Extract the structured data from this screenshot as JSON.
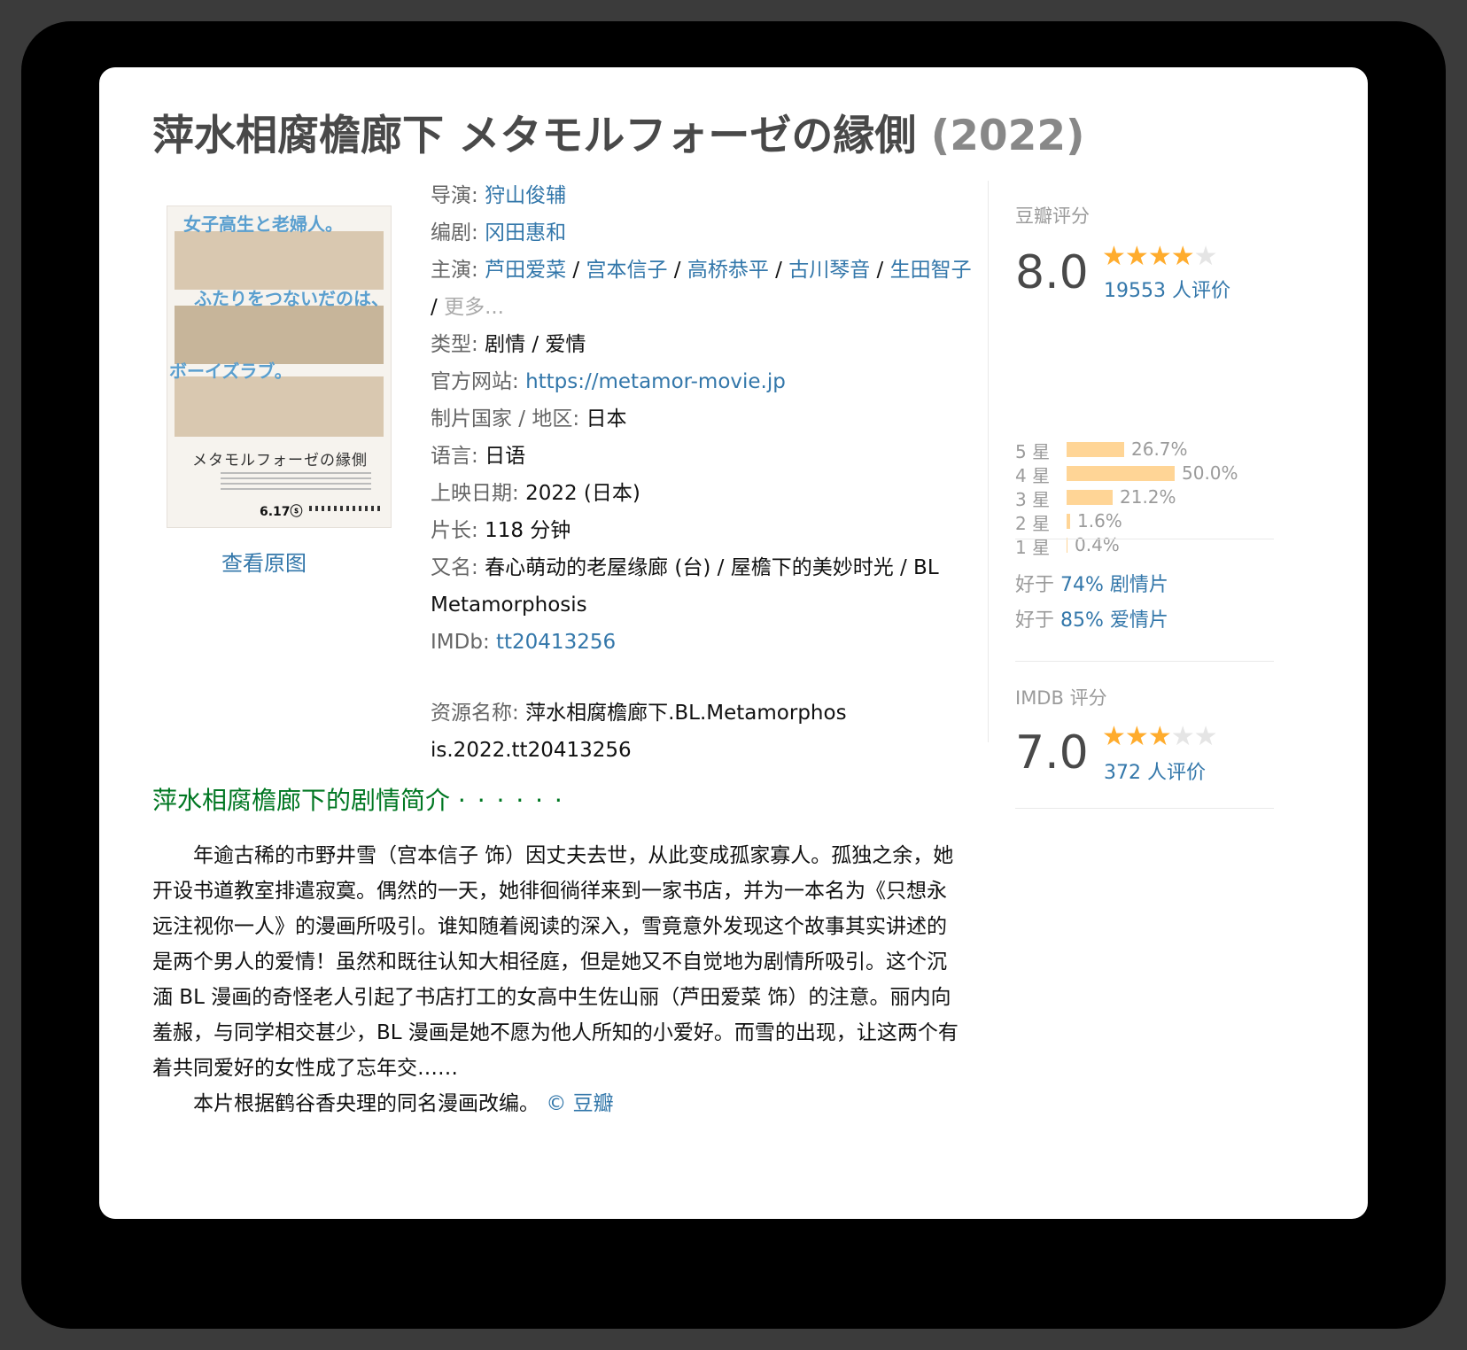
{
  "title": "萍水相腐檐廊下 メタモルフォーゼの縁側",
  "year": "(2022)",
  "poster": {
    "caption1": "女子高生と老婦人。",
    "caption2": "ふたりをつないだのは、",
    "caption3": "ボーイズラブ。",
    "title_jp": "メタモルフォーゼの縁側",
    "date": "6.17ⓢ",
    "view_original": "查看原图"
  },
  "info": {
    "director_label": "导演",
    "director": "狩山俊辅",
    "writer_label": "编剧",
    "writer": "冈田惠和",
    "cast_label": "主演",
    "cast": [
      "芦田爱菜",
      "宫本信子",
      "高桥恭平",
      "古川琴音",
      "生田智子"
    ],
    "cast_more": "更多...",
    "genre_label": "类型",
    "genre": "剧情 / 爱情",
    "website_label": "官方网站",
    "website": "https://metamor-movie.jp",
    "country_label": "制片国家 / 地区",
    "country": "日本",
    "language_label": "语言",
    "language": "日语",
    "release_label": "上映日期",
    "release": "2022 (日本)",
    "runtime_label": "片长",
    "runtime": "118 分钟",
    "aka_label": "又名",
    "aka": "春心萌动的老屋缘廊 (台) / 屋檐下的美妙时光 / BL Metamorphosis",
    "imdb_label": "IMDb",
    "imdb": "tt20413256",
    "resource_label": "资源名称",
    "resource": "萍水相腐檐廊下.BL.Metamorphosis.2022.tt20413256"
  },
  "douban": {
    "label": "豆瓣评分",
    "score": "8.0",
    "stars": 4,
    "count": "19553 人评价",
    "distribution": [
      {
        "label": "5 星",
        "percent": 26.7,
        "text": "26.7%"
      },
      {
        "label": "4 星",
        "percent": 50.0,
        "text": "50.0%"
      },
      {
        "label": "3 星",
        "percent": 21.2,
        "text": "21.2%"
      },
      {
        "label": "2 星",
        "percent": 1.6,
        "text": "1.6%"
      },
      {
        "label": "1 星",
        "percent": 0.4,
        "text": "0.4%"
      }
    ],
    "better1_prefix": "好于",
    "better1_link": "74% 剧情片",
    "better2_prefix": "好于",
    "better2_link": "85% 爱情片"
  },
  "imdb_rating": {
    "label": "IMDB 评分",
    "score": "7.0",
    "stars": 3,
    "count": "372 人评价"
  },
  "summary": {
    "title": "萍水相腐檐廊下的剧情简介",
    "dots": "· · · · · ·",
    "para1": "年逾古稀的市野井雪（宫本信子 饰）因丈夫去世，从此变成孤家寡人。孤独之余，她开设书道教室排遣寂寞。偶然的一天，她徘徊徜徉来到一家书店，并为一本名为《只想永远注视你一人》的漫画所吸引。谁知随着阅读的深入，雪竟意外发现这个故事其实讲述的是两个男人的爱情！虽然和既往认知大相径庭，但是她又不自觉地为剧情所吸引。这个沉湎 BL 漫画的奇怪老人引起了书店打工的女高中生佐山丽（芦田爱菜 饰）的注意。丽内向羞赧，与同学相交甚少，BL 漫画是她不愿为他人所知的小爱好。而雪的出现，让这两个有着共同爱好的女性成了忘年交……",
    "para2": "本片根据鹤谷香央理的同名漫画改编。",
    "credit": "© 豆瓣"
  },
  "colors": {
    "link": "#3377aa",
    "star": "#ffac2d",
    "bar": "#ffd596",
    "section_title": "#007722"
  }
}
